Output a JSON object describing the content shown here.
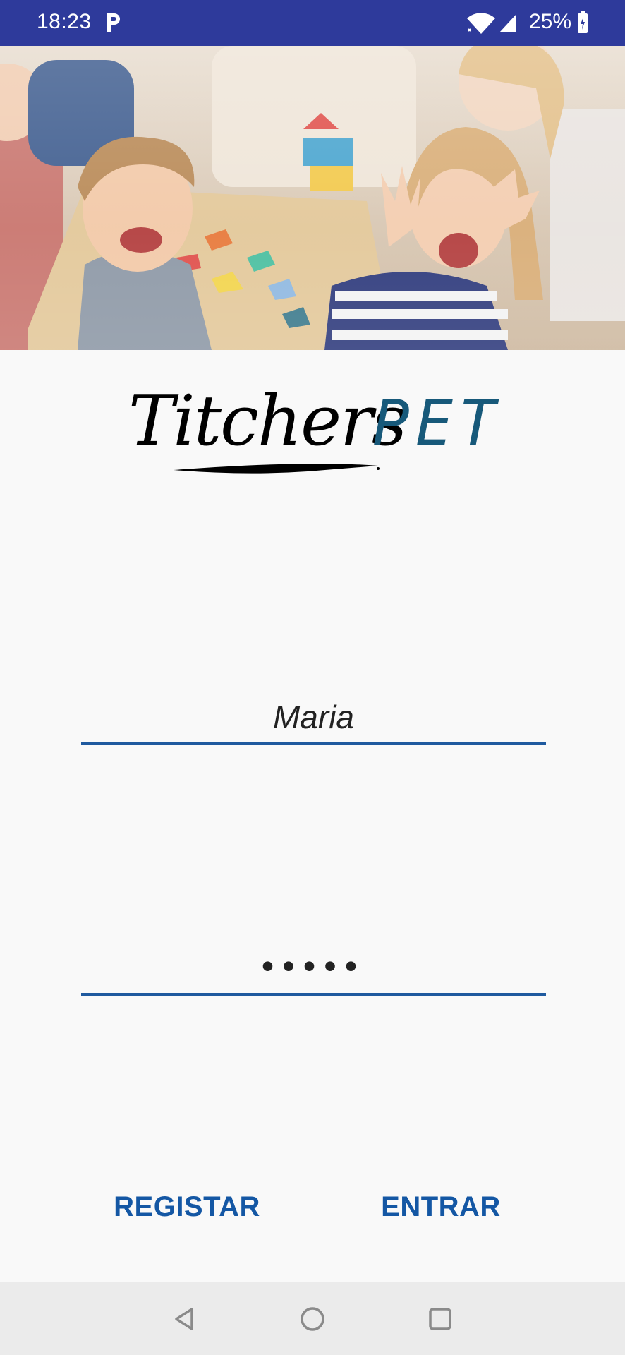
{
  "status_bar": {
    "time": "18:23",
    "notification_icon": "parking-p-icon",
    "battery_percent": "25%",
    "background_color": "#2e3a9b"
  },
  "hero": {
    "image": "children-playing-photo"
  },
  "logo": {
    "script_part": "Titchers",
    "accent_part": "PET",
    "accent_color": "#17597a"
  },
  "login_form": {
    "username_value": "Maria",
    "password_value": "•••••",
    "underline_color": "#1f5a9f"
  },
  "actions": {
    "register_label": "REGISTAR",
    "login_label": "ENTRAR",
    "button_color": "#1457a4"
  },
  "nav_bar": {
    "back_icon": "back-triangle-icon",
    "home_icon": "home-circle-icon",
    "recents_icon": "recents-square-icon"
  }
}
